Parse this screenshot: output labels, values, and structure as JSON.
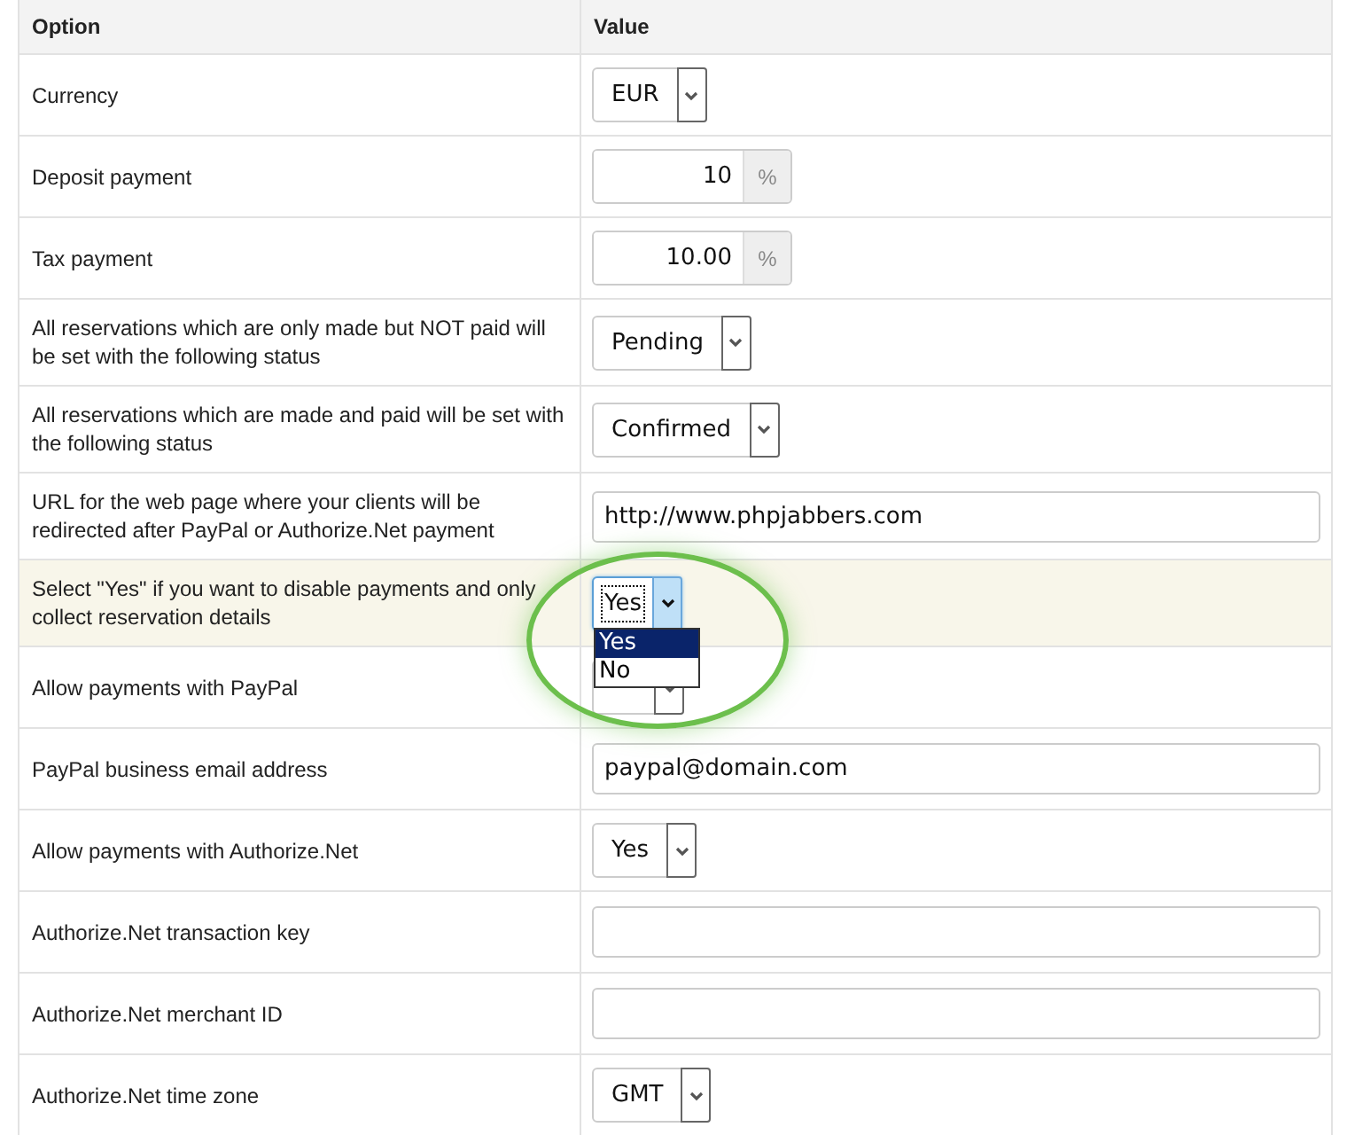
{
  "table": {
    "columns": [
      "Option",
      "Value"
    ],
    "rows": [
      {
        "label": "Currency",
        "highlighted": false,
        "control": {
          "kind": "select",
          "value": "EUR"
        }
      },
      {
        "label": "Deposit payment",
        "highlighted": false,
        "control": {
          "kind": "number",
          "value": "10",
          "suffix": "%"
        }
      },
      {
        "label": "Tax payment",
        "highlighted": false,
        "control": {
          "kind": "number",
          "value": "10.00",
          "suffix": "%"
        }
      },
      {
        "label": "All reservations which are only made but NOT paid will be set with the following status",
        "highlighted": false,
        "control": {
          "kind": "select",
          "value": "Pending"
        }
      },
      {
        "label": "All reservations which are made and paid will be set with the following status",
        "highlighted": false,
        "control": {
          "kind": "select",
          "value": "Confirmed"
        }
      },
      {
        "label": "URL for the web page where your clients will be redirected after PayPal or Authorize.Net payment",
        "highlighted": false,
        "control": {
          "kind": "text",
          "value": "http://www.phpjabbers.com"
        }
      },
      {
        "label": "Select \"Yes\" if you want to disable payments and only collect reservation details",
        "highlighted": true,
        "control": {
          "kind": "select",
          "value": "Yes",
          "focused": true,
          "expanded": true,
          "options": [
            {
              "label": "Yes",
              "selected": true
            },
            {
              "label": "No",
              "selected": false
            }
          ]
        }
      },
      {
        "label": "Allow payments with PayPal",
        "highlighted": false,
        "control": {
          "kind": "select"
        }
      },
      {
        "label": "PayPal business email address",
        "highlighted": false,
        "control": {
          "kind": "text",
          "value": "paypal@domain.com"
        }
      },
      {
        "label": "Allow payments with Authorize.Net",
        "highlighted": false,
        "control": {
          "kind": "select",
          "value": "Yes"
        }
      },
      {
        "label": "Authorize.Net transaction key",
        "highlighted": false,
        "control": {
          "kind": "text"
        }
      },
      {
        "label": "Authorize.Net merchant ID",
        "highlighted": false,
        "control": {
          "kind": "text"
        }
      },
      {
        "label": "Authorize.Net time zone",
        "highlighted": false,
        "control": {
          "kind": "select",
          "value": "GMT"
        }
      }
    ]
  }
}
